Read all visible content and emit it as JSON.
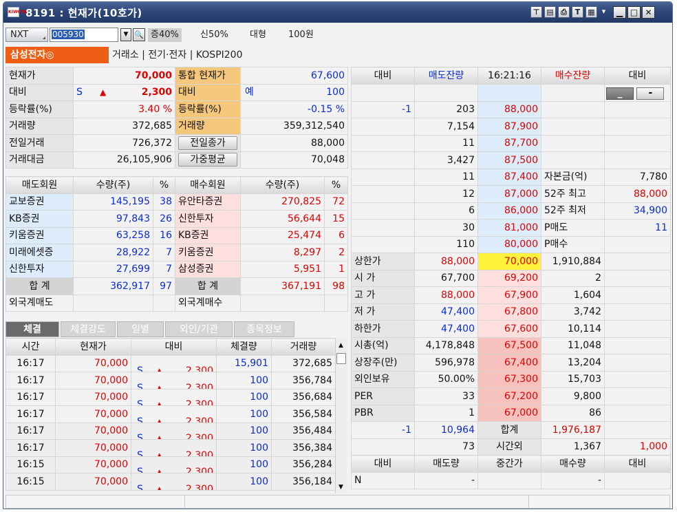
{
  "window": {
    "title": "8191 : 현재가(10호가)",
    "app_icon": "app-logo-icon"
  },
  "toolbar": {
    "icons": [
      "pin-icon",
      "copy-icon",
      "print-icon",
      "text-icon",
      "settings-icon",
      "menu-icon"
    ],
    "minimize": "▁",
    "maximize": "□",
    "close": "✕"
  },
  "header": {
    "market_select": "NXT",
    "stock_code": "005930",
    "margin": "증40%",
    "credit": "신50%",
    "size": "대형",
    "par": "100원"
  },
  "stock": {
    "name": "삼성전자◎",
    "exchange": "거래소",
    "sector": "전기·전자",
    "index": "KOSPI200"
  },
  "summary": {
    "rows": [
      {
        "l1": "현재가",
        "v1": "70,000",
        "l2": "통합 현재가",
        "m2": "",
        "v2": "67,600"
      },
      {
        "l1": "대비",
        "mark": "S",
        "arrow": "▲",
        "v1": "2,300",
        "l2": "대비",
        "m2": "예",
        "v2": "100"
      },
      {
        "l1": "등락률(%)",
        "v1": "3.40 %",
        "l2": "등락률(%)",
        "m2": "",
        "v2": "-0.15 %"
      },
      {
        "l1": "거래량",
        "v1": "372,685",
        "l2": "거래량",
        "m2": "",
        "v2": "359,312,540"
      },
      {
        "l1": "전일거래",
        "v1": "726,372",
        "l2": "전일종가",
        "m2": "",
        "v2": "88,000"
      },
      {
        "l1": "거래대금",
        "v1": "26,105,906",
        "l2": "가중평균",
        "m2": "",
        "v2": "70,048"
      }
    ]
  },
  "members": {
    "headers": [
      "매도회원",
      "수량(주)",
      "%",
      "매수회원",
      "수량(주)",
      "%"
    ],
    "rows": [
      {
        "sell": "교보증권",
        "sq": "145,195",
        "sp": "38",
        "buy": "유안타증권",
        "bq": "270,825",
        "bp": "72"
      },
      {
        "sell": "KB증권",
        "sq": "97,843",
        "sp": "26",
        "buy": "신한투자",
        "bq": "56,644",
        "bp": "15"
      },
      {
        "sell": "키움증권",
        "sq": "63,258",
        "sp": "16",
        "buy": "KB증권",
        "bq": "25,474",
        "bp": "6"
      },
      {
        "sell": "미래에셋증",
        "sq": "28,922",
        "sp": "7",
        "buy": "키움증권",
        "bq": "8,297",
        "bp": "2"
      },
      {
        "sell": "신한투자",
        "sq": "27,699",
        "sp": "7",
        "buy": "삼성증권",
        "bq": "5,951",
        "bp": "1"
      },
      {
        "sell": "합  계",
        "sq": "362,917",
        "sp": "97",
        "buy": "합  계",
        "bq": "367,191",
        "bp": "98"
      },
      {
        "sell": "외국계매도",
        "sq": "",
        "sp": "",
        "buy": "외국계매수",
        "bq": "",
        "bp": ""
      }
    ]
  },
  "tabs": [
    "체결",
    "체결강도",
    "일별",
    "외인/기관",
    "종목정보"
  ],
  "trades": {
    "headers": [
      "시간",
      "현재가",
      "대비",
      "체결량",
      "거래량"
    ],
    "rows": [
      {
        "t": "16:17",
        "p": "70,000",
        "s": "S",
        "a": "▲",
        "d": "2,300",
        "q": "15,901",
        "v": "372,685"
      },
      {
        "t": "16:17",
        "p": "70,000",
        "s": "S",
        "a": "▲",
        "d": "2,300",
        "q": "100",
        "v": "356,784"
      },
      {
        "t": "16:17",
        "p": "70,000",
        "s": "S",
        "a": "▲",
        "d": "2,300",
        "q": "100",
        "v": "356,684"
      },
      {
        "t": "16:17",
        "p": "70,000",
        "s": "S",
        "a": "▲",
        "d": "2,300",
        "q": "100",
        "v": "356,584"
      },
      {
        "t": "16:17",
        "p": "70,000",
        "s": "S",
        "a": "▲",
        "d": "2,300",
        "q": "100",
        "v": "356,484"
      },
      {
        "t": "16:17",
        "p": "70,000",
        "s": "S",
        "a": "▲",
        "d": "2,300",
        "q": "100",
        "v": "356,384"
      },
      {
        "t": "16:15",
        "p": "70,000",
        "s": "S",
        "a": "▲",
        "d": "2,300",
        "q": "100",
        "v": "356,284"
      },
      {
        "t": "16:15",
        "p": "70,000",
        "s": "S",
        "a": "▲",
        "d": "2,300",
        "q": "100",
        "v": "356,184"
      }
    ]
  },
  "orderbook": {
    "headers": [
      "대비",
      "매도잔량",
      "16:21:16",
      "매수잔량",
      "대비"
    ],
    "btn_minus": "_",
    "btn_dash": "-",
    "asks": [
      {
        "chg": "",
        "qty": "",
        "price": ""
      },
      {
        "chg": "-1",
        "qty": "203",
        "price": "88,000"
      },
      {
        "chg": "",
        "qty": "7,154",
        "price": "87,900"
      },
      {
        "chg": "",
        "qty": "11",
        "price": "87,700"
      },
      {
        "chg": "",
        "qty": "3,427",
        "price": "87,500"
      },
      {
        "chg": "",
        "qty": "11",
        "price": "87,400",
        "l": "자본금(억)",
        "r": "7,780"
      },
      {
        "chg": "",
        "qty": "12",
        "price": "87,000",
        "l": "52주 최고",
        "r": "88,000"
      },
      {
        "chg": "",
        "qty": "6",
        "price": "86,000",
        "l": "52주 최저",
        "r": "34,900"
      },
      {
        "chg": "",
        "qty": "30",
        "price": "81,000",
        "l": "P매도",
        "r": "11"
      },
      {
        "chg": "",
        "qty": "110",
        "price": "80,000",
        "l": "P매수",
        "r": ""
      }
    ],
    "bids": [
      {
        "l": "상한가",
        "lv": "88,000",
        "price": "70,000",
        "qty": "1,910,884"
      },
      {
        "l": "시  가",
        "lv": "67,700",
        "price": "69,200",
        "qty": "2"
      },
      {
        "l": "고  가",
        "lv": "88,000",
        "price": "67,900",
        "qty": "1,604"
      },
      {
        "l": "저  가",
        "lv": "47,400",
        "price": "67,800",
        "qty": "3,742"
      },
      {
        "l": "하한가",
        "lv": "47,400",
        "price": "67,600",
        "qty": "10,114"
      },
      {
        "l": "시총(억)",
        "lv": "4,178,848",
        "price": "67,500",
        "qty": "11,048"
      },
      {
        "l": "상장주(만)",
        "lv": "596,978",
        "price": "67,400",
        "qty": "13,204"
      },
      {
        "l": "외인보유",
        "lv": "50.00%",
        "price": "67,300",
        "qty": "15,703"
      },
      {
        "l": "PER",
        "lv": "33",
        "price": "67,200",
        "qty": "9,800"
      },
      {
        "l": "PBR",
        "lv": "1",
        "price": "67,000",
        "qty": "86"
      }
    ],
    "total": {
      "chg": "-1",
      "sell": "10,964",
      "label": "합계",
      "buy": "1,976,187"
    },
    "after": {
      "sell": "73",
      "label": "시간외",
      "buy": "1,367",
      "chg": "1,000"
    },
    "footer_headers": [
      "대비",
      "매도량",
      "중간가",
      "매수량",
      "대비"
    ],
    "footer_row": {
      "c1": "N",
      "c2": "-",
      "c3": "",
      "c4": "-",
      "c5": ""
    }
  }
}
